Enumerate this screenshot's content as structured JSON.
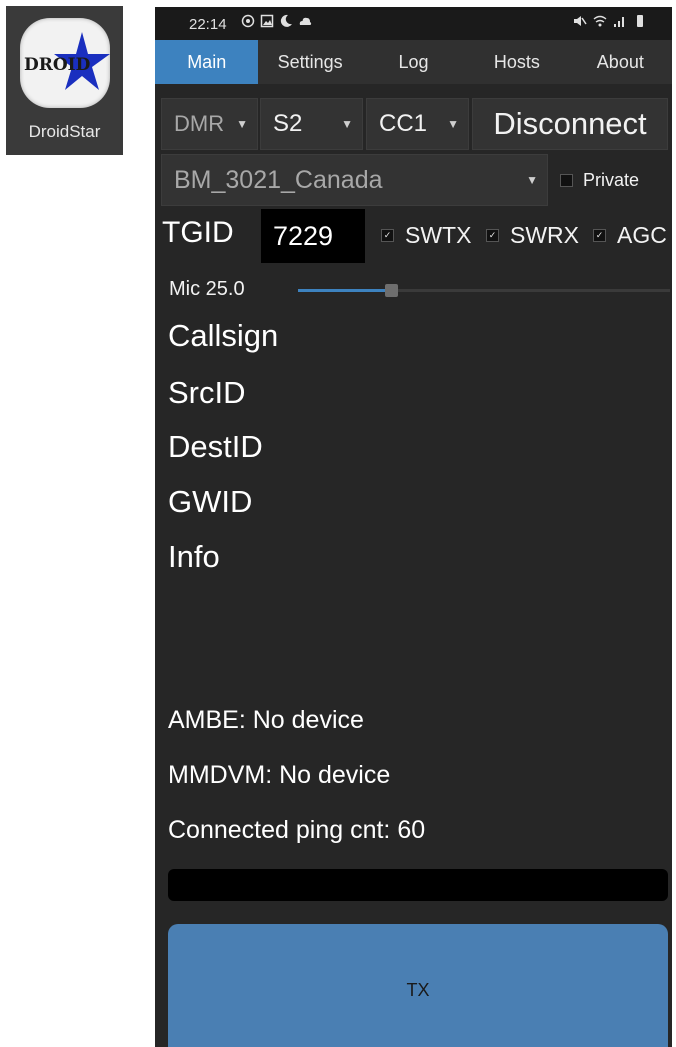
{
  "launcher": {
    "label": "DroidStar",
    "logo_text": "DROID"
  },
  "statusbar": {
    "time": "22:14",
    "left_icons": [
      "whatsapp-icon",
      "gallery-icon",
      "moon-icon",
      "cloud-icon"
    ],
    "right_icons": [
      "mute-icon",
      "wifi-icon",
      "signal-icon",
      "battery-icon"
    ]
  },
  "tabs": [
    {
      "label": "Main",
      "active": true
    },
    {
      "label": "Settings",
      "active": false
    },
    {
      "label": "Log",
      "active": false
    },
    {
      "label": "Hosts",
      "active": false
    },
    {
      "label": "About",
      "active": false
    }
  ],
  "controls": {
    "mode": "DMR",
    "slot": "S2",
    "color_code": "CC1",
    "connect_button": "Disconnect",
    "host": "BM_3021_Canada",
    "private_label": "Private",
    "private_checked": false,
    "tgid_label": "TGID",
    "tgid_value": "7229",
    "swtx_label": "SWTX",
    "swtx_checked": true,
    "swrx_label": "SWRX",
    "swrx_checked": true,
    "agc_label": "AGC",
    "agc_checked": true,
    "mic_label": "Mic 25.0",
    "mic_level_fraction": 0.25
  },
  "info": {
    "callsign": "Callsign",
    "srcid": "SrcID",
    "destid": "DestID",
    "gwid": "GWID",
    "info": "Info"
  },
  "status": {
    "ambe": "AMBE: No device",
    "mmdvm": "MMDVM: No device",
    "ping": "Connected ping cnt: 60"
  },
  "tx_button": "TX",
  "colors": {
    "accent": "#3d82bf",
    "background": "#262626",
    "tx_button": "#4a7fb3"
  }
}
